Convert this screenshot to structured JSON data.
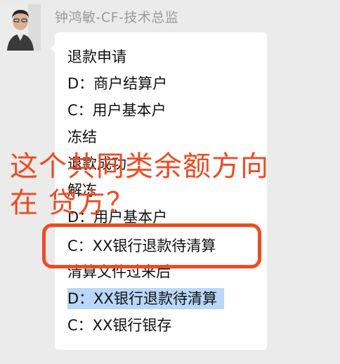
{
  "chat": {
    "sender_name": "钟鸿敏-CF-技术总监",
    "avatar_icon": "person-avatar",
    "message_lines": [
      "退款申请",
      "D：商户结算户",
      "C：用户基本户",
      "冻结",
      "退款成功",
      "解冻",
      "D：用户基本户",
      "C：XX银行退款待清算",
      "清算文件过来后",
      "D：XX银行退款待清算",
      "C：XX银行银存"
    ]
  },
  "annotation": {
    "line1": "这个共同类余额方向",
    "line2": "在 贷方？",
    "color": "#ef4a22"
  },
  "colors": {
    "background": "#ebebeb",
    "bubble": "#ffffff",
    "selection": "#b9d7f8"
  }
}
